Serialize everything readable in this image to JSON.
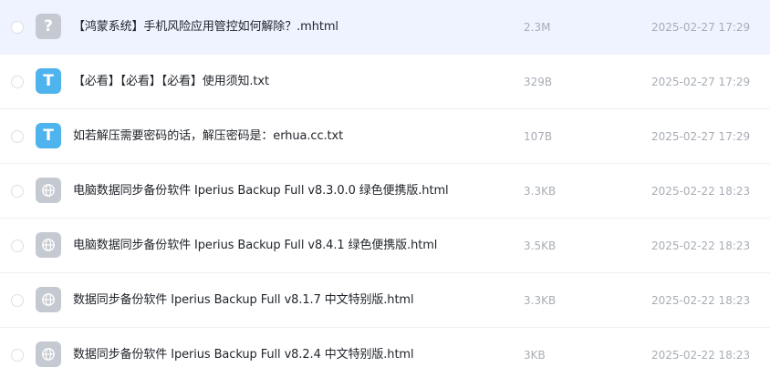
{
  "files": [
    {
      "icon": "question-icon",
      "glyph": "?",
      "name": "【鸿蒙系统】手机风险应用管控如何解除？.mhtml",
      "size": "2.3M",
      "date": "2025-02-27 17:29",
      "selected": true
    },
    {
      "icon": "text-file-icon",
      "glyph": "T",
      "name": "【必看】【必看】【必看】使用须知.txt",
      "size": "329B",
      "date": "2025-02-27 17:29",
      "selected": false
    },
    {
      "icon": "text-file-icon",
      "glyph": "T",
      "name": "如若解压需要密码的话，解压密码是：erhua.cc.txt",
      "size": "107B",
      "date": "2025-02-27 17:29",
      "selected": false
    },
    {
      "icon": "globe-icon",
      "glyph": "",
      "name": "电脑数据同步备份软件 Iperius Backup Full v8.3.0.0 绿色便携版.html",
      "size": "3.3KB",
      "date": "2025-02-22 18:23",
      "selected": false
    },
    {
      "icon": "globe-icon",
      "glyph": "",
      "name": "电脑数据同步备份软件 Iperius Backup Full v8.4.1 绿色便携版.html",
      "size": "3.5KB",
      "date": "2025-02-22 18:23",
      "selected": false
    },
    {
      "icon": "globe-icon",
      "glyph": "",
      "name": "数据同步备份软件 Iperius Backup Full v8.1.7 中文特别版.html",
      "size": "3.3KB",
      "date": "2025-02-22 18:23",
      "selected": false
    },
    {
      "icon": "globe-icon",
      "glyph": "",
      "name": "数据同步备份软件 Iperius Backup Full v8.2.4 中文特别版.html",
      "size": "3KB",
      "date": "2025-02-22 18:23",
      "selected": false
    }
  ],
  "colors": {
    "selected_row_bg": "#eef3ff",
    "txt_icon": "#4fb3ee",
    "generic_icon": "#c5c9d1",
    "meta_text": "#a8adb5",
    "name_text": "#1f2329"
  }
}
